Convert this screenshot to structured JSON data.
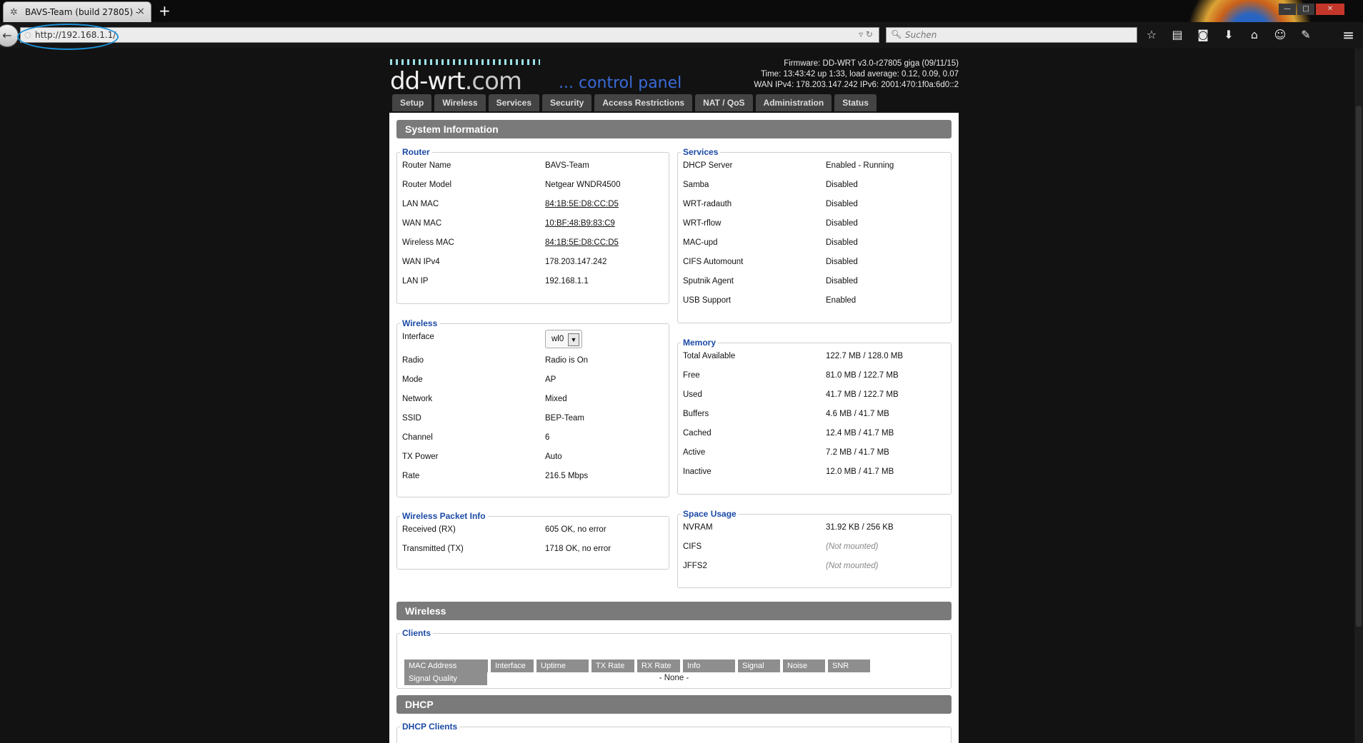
{
  "browser": {
    "tab_title": "BAVS-Team (build 27805) - ...",
    "new_tab": "+",
    "url": "http://192.168.1.1/",
    "search_placeholder": "Suchen"
  },
  "header": {
    "logo_main": "dd-wrt",
    "logo_domain": ".com",
    "logo_tagline": "... control panel",
    "firmware": "Firmware: DD-WRT v3.0-r27805 giga (09/11/15)",
    "time": "Time: 13:43:42 up 1:33, load average: 0.12, 0.09, 0.07",
    "wan": "WAN IPv4: 178.203.147.242 IPv6: 2001:470:1f0a:6d0::2"
  },
  "tabs": [
    "Setup",
    "Wireless",
    "Services",
    "Security",
    "Access Restrictions",
    "NAT / QoS",
    "Administration",
    "Status"
  ],
  "sections": {
    "system_information": "System Information",
    "wireless": "Wireless",
    "dhcp": "DHCP"
  },
  "router": {
    "legend": "Router",
    "rows": [
      {
        "label": "Router Name",
        "value": "BAVS-Team"
      },
      {
        "label": "Router Model",
        "value": "Netgear WNDR4500"
      },
      {
        "label": "LAN MAC",
        "value": "84:1B:5E:D8:CC:D5"
      },
      {
        "label": "WAN MAC",
        "value": "10:BF:48:B9:83:C9"
      },
      {
        "label": "Wireless MAC",
        "value": "84:1B:5E:D8:CC:D5"
      },
      {
        "label": "WAN IPv4",
        "value": "178.203.147.242"
      },
      {
        "label": "LAN IP",
        "value": "192.168.1.1"
      }
    ]
  },
  "wireless": {
    "legend": "Wireless",
    "interface_label": "Interface",
    "interface_value": "wl0",
    "rows": [
      {
        "label": "Radio",
        "value": "Radio is On"
      },
      {
        "label": "Mode",
        "value": "AP"
      },
      {
        "label": "Network",
        "value": "Mixed"
      },
      {
        "label": "SSID",
        "value": "BEP-Team"
      },
      {
        "label": "Channel",
        "value": "6"
      },
      {
        "label": "TX Power",
        "value": "Auto"
      },
      {
        "label": "Rate",
        "value": "216.5 Mbps"
      }
    ]
  },
  "packet_info": {
    "legend": "Wireless Packet Info",
    "rows": [
      {
        "label": "Received (RX)",
        "value": "605 OK, no error"
      },
      {
        "label": "Transmitted (TX)",
        "value": "1718 OK, no error"
      }
    ]
  },
  "services": {
    "legend": "Services",
    "rows": [
      {
        "label": "DHCP Server",
        "value": "Enabled - Running"
      },
      {
        "label": "Samba",
        "value": "Disabled"
      },
      {
        "label": "WRT-radauth",
        "value": "Disabled"
      },
      {
        "label": "WRT-rflow",
        "value": "Disabled"
      },
      {
        "label": "MAC-upd",
        "value": "Disabled"
      },
      {
        "label": "CIFS Automount",
        "value": "Disabled"
      },
      {
        "label": "Sputnik Agent",
        "value": "Disabled"
      },
      {
        "label": "USB Support",
        "value": "Enabled"
      }
    ]
  },
  "memory": {
    "legend": "Memory",
    "rows": [
      {
        "label": "Total Available",
        "value": "122.7 MB / 128.0 MB"
      },
      {
        "label": "Free",
        "value": "81.0 MB / 122.7 MB"
      },
      {
        "label": "Used",
        "value": "41.7 MB / 122.7 MB"
      },
      {
        "label": "Buffers",
        "value": "4.6 MB / 41.7 MB"
      },
      {
        "label": "Cached",
        "value": "12.4 MB / 41.7 MB"
      },
      {
        "label": "Active",
        "value": "7.2 MB / 41.7 MB"
      },
      {
        "label": "Inactive",
        "value": "12.0 MB / 41.7 MB"
      }
    ]
  },
  "space": {
    "legend": "Space Usage",
    "rows": [
      {
        "label": "NVRAM",
        "value": "31.92 KB / 256 KB"
      },
      {
        "label": "CIFS",
        "value": "(Not mounted)"
      },
      {
        "label": "JFFS2",
        "value": "(Not mounted)"
      }
    ]
  },
  "clients": {
    "legend": "Clients",
    "columns": [
      "MAC Address",
      "Interface",
      "Uptime",
      "TX Rate",
      "RX Rate",
      "Info",
      "Signal",
      "Noise",
      "SNR",
      "Signal Quality"
    ],
    "empty": "- None -"
  },
  "dhcp_clients": {
    "legend": "DHCP Clients"
  }
}
